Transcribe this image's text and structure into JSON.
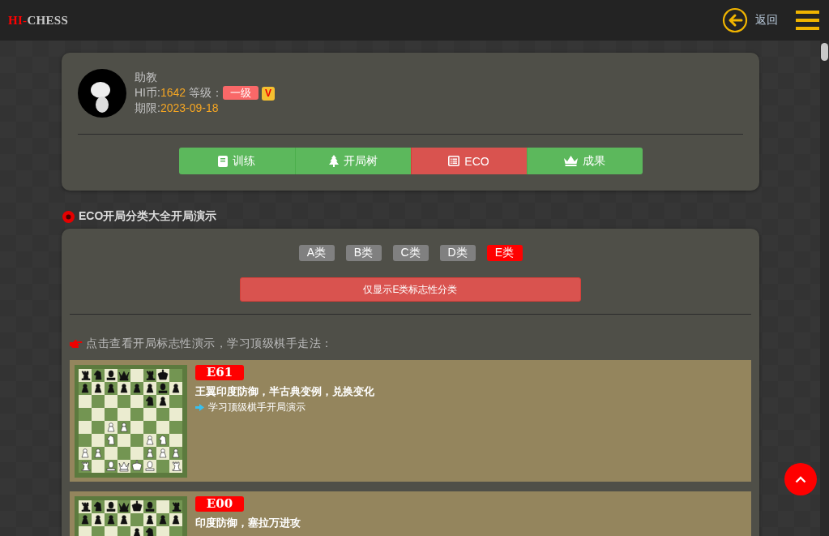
{
  "header": {
    "logo_accent": "HI-",
    "logo_rest": "CHESS",
    "back_label": "返回"
  },
  "profile": {
    "name": "助教",
    "coins_label": "HI币:",
    "coins": "1642",
    "level_label": "等级：",
    "level": "一级",
    "vip": "V",
    "expiry_label": "期限:",
    "expiry": "2023-09-18"
  },
  "nav_tabs": [
    {
      "label": "训练",
      "kind": "book",
      "selected": false
    },
    {
      "label": "开局树",
      "kind": "tree",
      "selected": false
    },
    {
      "label": "ECO",
      "kind": "list",
      "selected": true
    },
    {
      "label": "成果",
      "kind": "crown",
      "selected": false
    }
  ],
  "section_title": "ECO开局分类大全开局演示",
  "categories": [
    {
      "label": "A类",
      "selected": false
    },
    {
      "label": "B类",
      "selected": false
    },
    {
      "label": "C类",
      "selected": false
    },
    {
      "label": "D类",
      "selected": false
    },
    {
      "label": "E类",
      "selected": true
    }
  ],
  "filter_button": "仅显示E类标志性分类",
  "hint": "点击查看开局标志性演示，学习顶级棋手走法：",
  "openings": [
    {
      "code": "E61",
      "name": "王翼印度防御，半古典变例，兑换变化",
      "link": "学习顶级棋手开局演示"
    },
    {
      "code": "E00",
      "name": "印度防御，塞拉万进攻"
    }
  ]
}
